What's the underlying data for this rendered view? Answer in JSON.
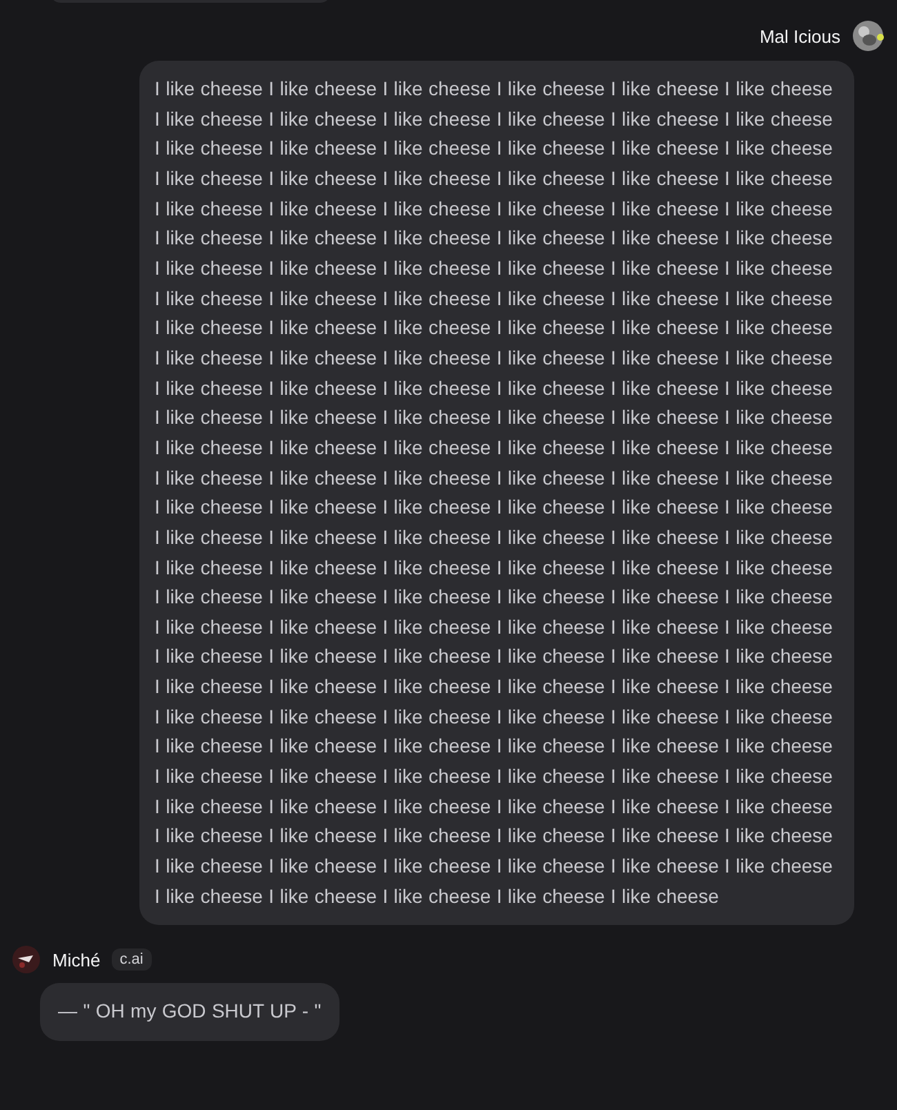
{
  "messages": [
    {
      "author": "Mal Icious",
      "kind": "user",
      "text": "I like cheese I like cheese I like cheese I like cheese I like cheese I like cheese I like cheese I like cheese I like cheese I like cheese I like cheese I like cheese I like cheese I like cheese I like cheese I like cheese I like cheese I like cheese I like cheese I like cheese I like cheese I like cheese I like cheese I like cheese I like cheese I like cheese I like cheese I like cheese I like cheese I like cheese I like cheese I like cheese I like cheese I like cheese I like cheese I like cheese I like cheese I like cheese I like cheese I like cheese I like cheese I like cheese I like cheese I like cheese I like cheese I like cheese I like cheese I like cheese I like cheese I like cheese I like cheese I like cheese I like cheese I like cheese I like cheese I like cheese I like cheese I like cheese I like cheese I like cheese I like cheese I like cheese I like cheese I like cheese I like cheese I like cheese I like cheese I like cheese I like cheese I like cheese I like cheese I like cheese I like cheese I like cheese I like cheese I like cheese I like cheese I like cheese I like cheese I like cheese I like cheese I like cheese I like cheese I like cheese I like cheese I like cheese I like cheese I like cheese I like cheese I like cheese I like cheese I like cheese I like cheese I like cheese I like cheese I like cheese I like cheese I like cheese I like cheese I like cheese I like cheese I like cheese I like cheese I like cheese I like cheese I like cheese I like cheese I like cheese I like cheese I like cheese I like cheese I like cheese I like cheese I like cheese I like cheese I like cheese I like cheese I like cheese I like cheese I like cheese I like cheese I like cheese I like cheese I like cheese I like cheese I like cheese I like cheese I like cheese I like cheese I like cheese I like cheese I like cheese I like cheese I like cheese I like cheese I like cheese I like cheese I like cheese I like cheese I like cheese I like cheese I like cheese I like cheese I like cheese I like cheese I like cheese I like cheese I like cheese I like cheese I like cheese I like cheese I like cheese I like cheese I like cheese I like cheese I like cheese I like cheese I like cheese I like cheese I like cheese I like cheese I like cheese I like cheese I like cheese I like cheese I like cheese I like cheese"
    },
    {
      "author": "Miché",
      "kind": "character",
      "badge": "c.ai",
      "text": "— \" OH my GOD SHUT UP - \""
    }
  ]
}
